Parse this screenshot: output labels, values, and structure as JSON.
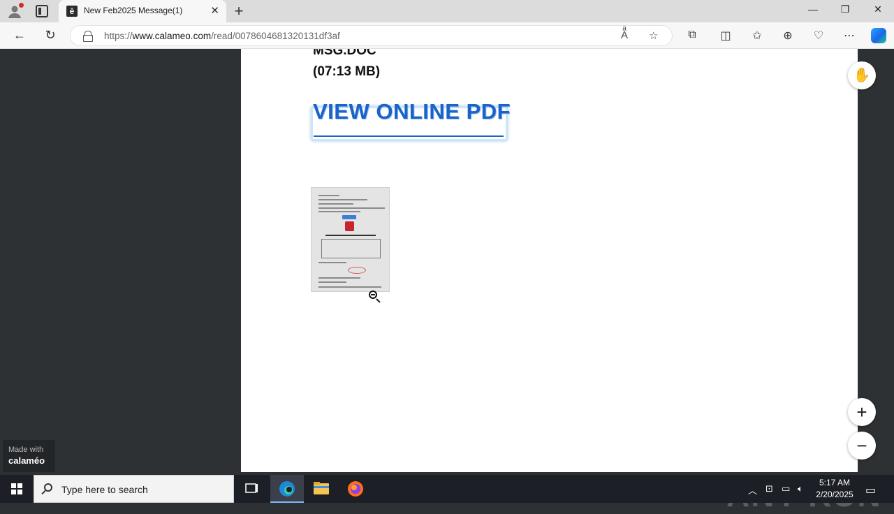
{
  "browser": {
    "tab": {
      "title": "New Feb2025 Message(1)",
      "favicon": "ē"
    },
    "url_prefix": "https://",
    "url_host": "www.calameo.com",
    "url_path": "/read/0078604681320131df3af",
    "icons": [
      "profile-icon",
      "tab-actions-icon",
      "close-icon",
      "new-tab-icon",
      "minimize-icon",
      "restore-icon",
      "window-close-icon",
      "back-icon",
      "refresh-icon",
      "lock-icon",
      "read-aloud-icon",
      "favorite-star-icon",
      "extensions-icon",
      "split-screen-icon",
      "favorites-icon",
      "collections-icon",
      "browser-essentials-icon",
      "more-icon",
      "copilot-icon"
    ]
  },
  "document": {
    "line1": "MSG.DOC",
    "line2": "(07:13 MB)",
    "cta": "VIEW ONLINE PDF"
  },
  "viewer": {
    "made_with": "Made with",
    "brand": "calaméo",
    "zoom_in": "+",
    "zoom_out": "−"
  },
  "watermark": "ANY RUN",
  "taskbar": {
    "search_placeholder": "Type here to search",
    "time": "5:17 AM",
    "date": "2/20/2025"
  }
}
